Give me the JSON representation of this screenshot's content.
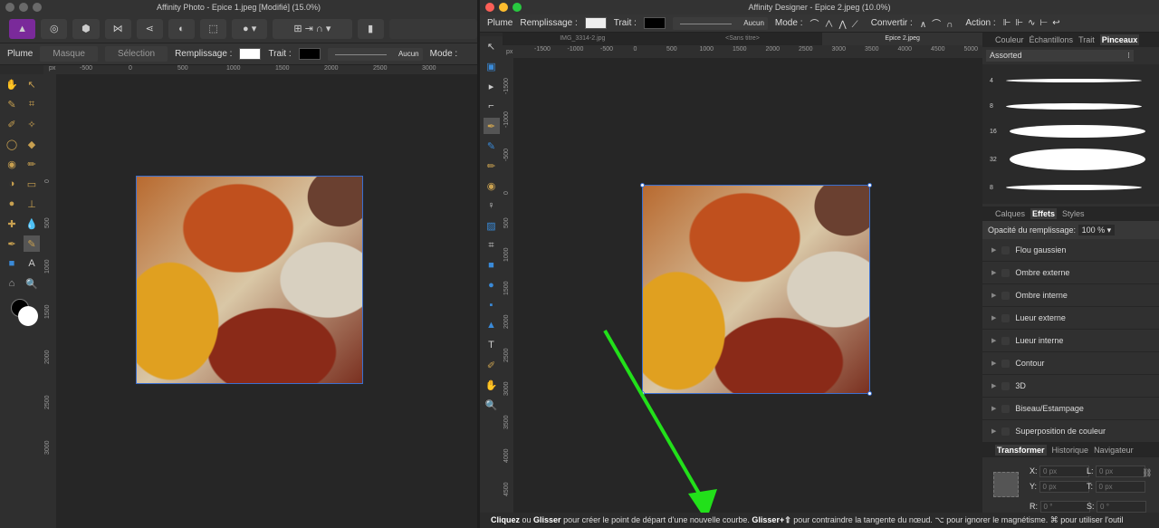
{
  "photo_window": {
    "title": "Affinity Photo - Epice 1.jpeg [Modifié] (15.0%)",
    "context": {
      "tool": "Plume",
      "mask": "Masque",
      "selection": "Sélection",
      "fill_label": "Remplissage :",
      "stroke_label": "Trait :",
      "stroke_value": "Aucun",
      "mode_label": "Mode :"
    },
    "ruler": {
      "unit": "px",
      "ticks": [
        "-500",
        "0",
        "500",
        "1000",
        "1500",
        "2000",
        "2500",
        "3000"
      ],
      "vticks": [
        "0",
        "500",
        "1000",
        "1500",
        "2000",
        "2500",
        "3000"
      ]
    }
  },
  "designer_window": {
    "title": "Affinity Designer - Epice 2.jpeg (10.0%)",
    "context": {
      "tool": "Plume",
      "fill_label": "Remplissage :",
      "stroke_label": "Trait :",
      "stroke_value": "Aucun",
      "mode_label": "Mode :",
      "convert_label": "Convertir :",
      "action_label": "Action :"
    },
    "doc_tabs": [
      "IMG_3314-2.jpg",
      "<Sans titre>",
      "Epice 2.jpeg"
    ],
    "ruler": {
      "unit": "px",
      "ticks": [
        "-1500",
        "-1000",
        "-500",
        "0",
        "500",
        "1000",
        "1500",
        "2000",
        "2500",
        "3000",
        "3500",
        "4000",
        "4500",
        "5000"
      ],
      "vticks": [
        "-1500",
        "-1000",
        "-500",
        "0",
        "500",
        "1000",
        "1500",
        "2000",
        "2500",
        "3000",
        "3500",
        "4000",
        "4500"
      ]
    },
    "panel_tabs": [
      "Couleur",
      "Échantillons",
      "Trait",
      "Pinceaux"
    ],
    "brush_category": "Assorted",
    "brush_sizes": [
      "4",
      "8",
      "16",
      "32",
      "8"
    ],
    "effects_tabs": [
      "Calques",
      "Effets",
      "Styles"
    ],
    "fill_opacity_label": "Opacité du remplissage:",
    "fill_opacity_value": "100 %",
    "effects": [
      "Flou gaussien",
      "Ombre externe",
      "Ombre interne",
      "Lueur externe",
      "Lueur interne",
      "Contour",
      "3D",
      "Biseau/Estampage",
      "Superposition de couleur"
    ],
    "transform_tabs": [
      "Transformer",
      "Historique",
      "Navigateur"
    ],
    "transform": {
      "x_label": "X:",
      "x": "0 px",
      "y_label": "Y:",
      "y": "0 px",
      "w_label": "L:",
      "w": "0 px",
      "h_label": "T:",
      "h": "0 px",
      "r_label": "R:",
      "r": "0 °",
      "s_label": "S:",
      "s": "0 °"
    },
    "status": {
      "b1": "Cliquez",
      "t1": " ou ",
      "b2": "Glisser",
      "t2": " pour créer le point de départ d'une nouvelle courbe. ",
      "b3": "Glisser+⇧",
      "t3": " pour contraindre la tangente du nœud. ⌥ pour ignorer le magnétisme. ⌘ pour utiliser l'outil"
    }
  },
  "annotation_color": "#22e01a"
}
